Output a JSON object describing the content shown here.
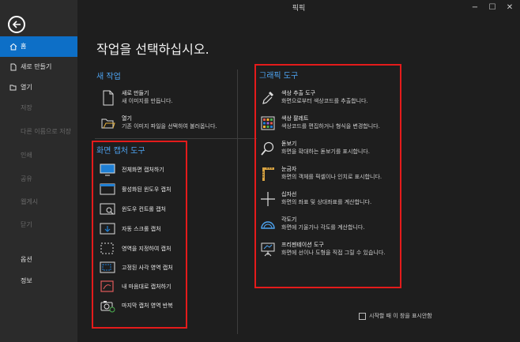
{
  "window": {
    "title": "픽픽",
    "controls": {
      "minimize": "−",
      "maximize": "☐",
      "close": "✕"
    }
  },
  "sidebar": {
    "items": [
      {
        "label": "홈",
        "icon": "home-icon",
        "state": "active"
      },
      {
        "label": "새로 만들기",
        "icon": "new-file-icon",
        "state": "normal"
      },
      {
        "label": "열기",
        "icon": "open-folder-icon",
        "state": "normal"
      },
      {
        "label": "저장",
        "state": "disabled"
      },
      {
        "label": "다른 이름으로 저장",
        "state": "disabled"
      },
      {
        "label": "인쇄",
        "state": "disabled"
      },
      {
        "label": "공유",
        "state": "disabled"
      },
      {
        "label": "웹게시",
        "state": "disabled"
      },
      {
        "label": "닫기",
        "state": "disabled"
      },
      {
        "label": "옵션",
        "state": "normal"
      },
      {
        "label": "정보",
        "state": "normal"
      }
    ]
  },
  "main": {
    "title": "작업을 선택하십시오.",
    "new_task": {
      "title": "새 작업",
      "items": [
        {
          "title": "새로 만들기",
          "desc": "새 이미지를 만듭니다.",
          "icon": "new-document-icon"
        },
        {
          "title": "열기",
          "desc": "기존 이미지 파일을 선택하여 불러옵니다.",
          "icon": "open-folder-icon"
        }
      ]
    },
    "capture_tools": {
      "title": "화면 캡처 도구",
      "items": [
        {
          "label": "전체화면 캡처하기",
          "icon": "fullscreen-capture-icon"
        },
        {
          "label": "활성화된 윈도우 캡처",
          "icon": "active-window-capture-icon"
        },
        {
          "label": "윈도우 컨트롤 캡처",
          "icon": "window-control-capture-icon"
        },
        {
          "label": "자동 스크롤 캡처",
          "icon": "scroll-capture-icon"
        },
        {
          "label": "영역을 지정하여 캡처",
          "icon": "region-capture-icon"
        },
        {
          "label": "고정된 사각 영역 캡처",
          "icon": "fixed-region-capture-icon"
        },
        {
          "label": "내 마음대로 캡처하기",
          "icon": "freehand-capture-icon"
        },
        {
          "label": "마지막 캡처 영역 반복",
          "icon": "repeat-capture-icon"
        }
      ]
    },
    "graphic_tools": {
      "title": "그래픽 도구",
      "items": [
        {
          "title": "색상 추출 도구",
          "desc": "화면으로부터 색상코드를 추출합니다.",
          "icon": "eyedropper-icon"
        },
        {
          "title": "색상 팔레트",
          "desc": "색상코드를 편집하거나 형식을 변경합니다.",
          "icon": "palette-icon"
        },
        {
          "title": "돋보기",
          "desc": "화면을 확대하는 돋보기를 표시합니다.",
          "icon": "magnifier-icon"
        },
        {
          "title": "눈금자",
          "desc": "화면의 객체를 픽셀이나 인치로 표시합니다.",
          "icon": "ruler-icon"
        },
        {
          "title": "십자선",
          "desc": "화면의 좌표 및 상대좌표를 계산합니다.",
          "icon": "crosshair-icon"
        },
        {
          "title": "각도기",
          "desc": "화면에 기울기나 각도를 계산합니다.",
          "icon": "protractor-icon"
        },
        {
          "title": "프리젠테이션 도구",
          "desc": "화면에 선이나 도형을 직접 그릴 수 있습니다.",
          "icon": "presentation-icon"
        }
      ]
    },
    "footer": {
      "checkbox_label": "시작할 때 이 창을 표시안함",
      "checked": false
    }
  },
  "colors": {
    "accent": "#0d6fc7",
    "section_title": "#4da3f0",
    "highlight_box": "#e41b1b"
  }
}
